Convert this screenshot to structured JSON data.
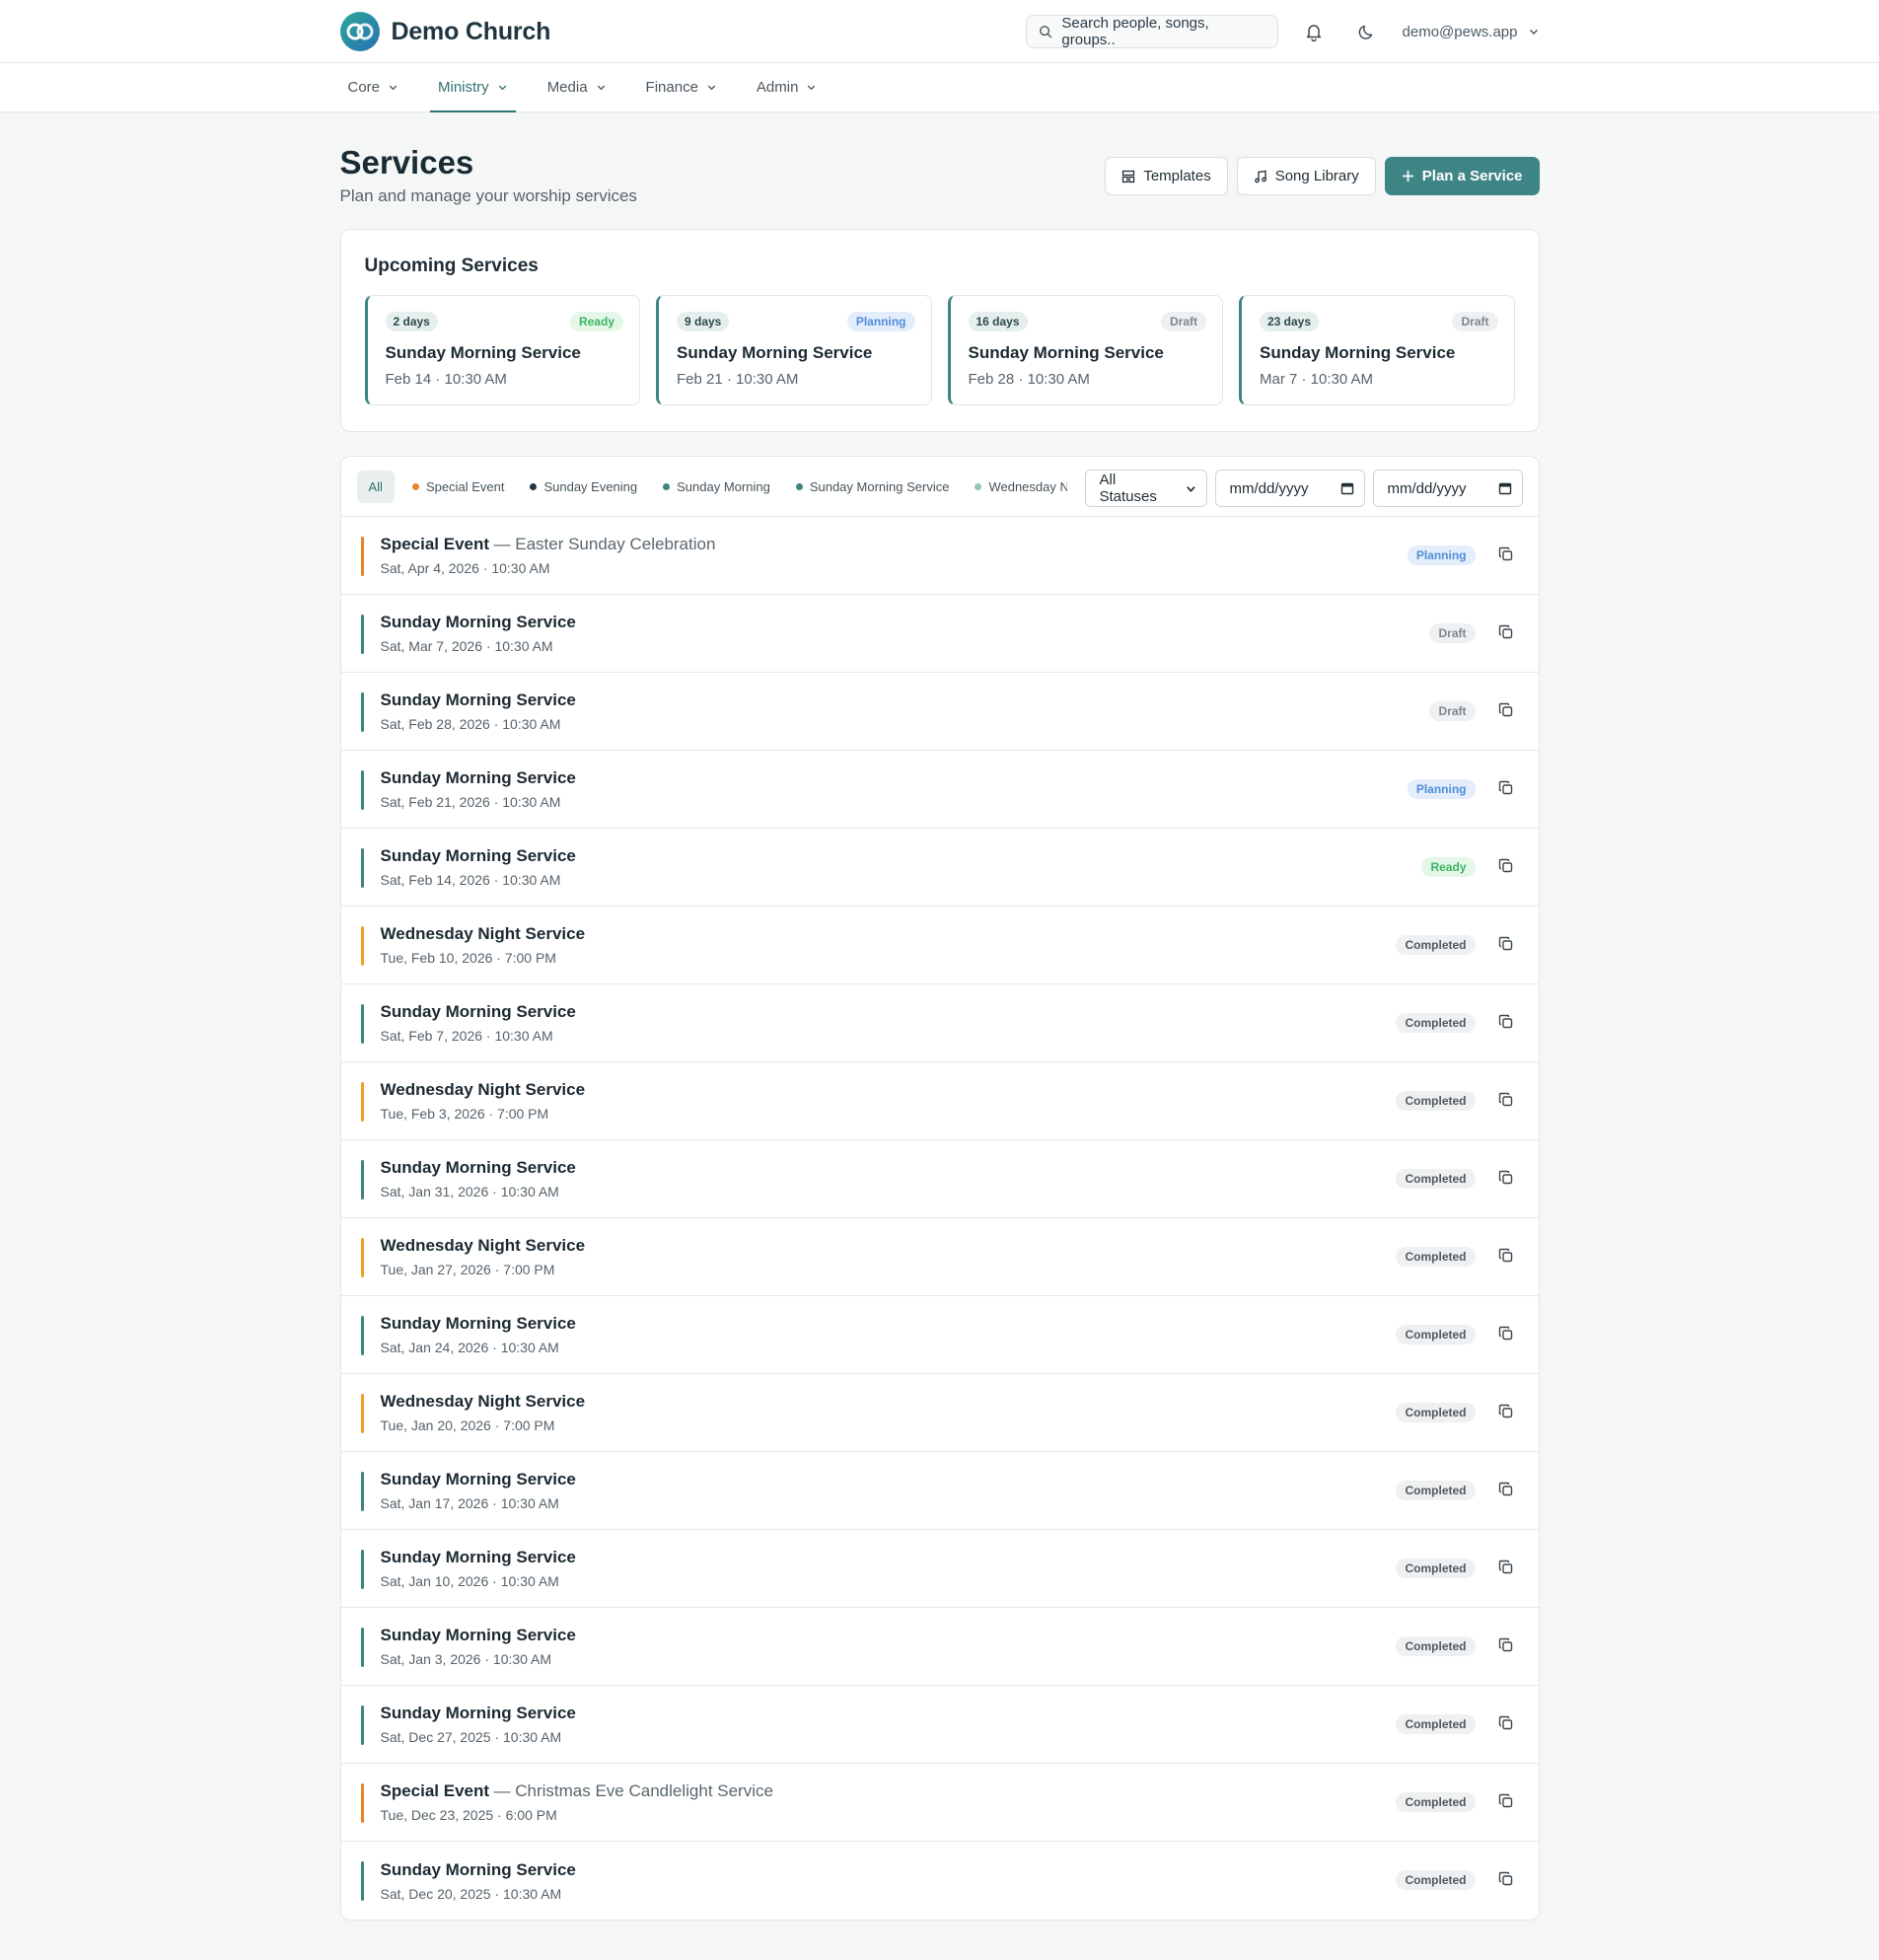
{
  "header": {
    "brand": "Demo Church",
    "search_placeholder": "Search people, songs, groups..",
    "user_email": "demo@pews.app"
  },
  "nav": {
    "items": [
      {
        "label": "Core",
        "active": false
      },
      {
        "label": "Ministry",
        "active": true
      },
      {
        "label": "Media",
        "active": false
      },
      {
        "label": "Finance",
        "active": false
      },
      {
        "label": "Admin",
        "active": false
      }
    ]
  },
  "page": {
    "title": "Services",
    "subtitle": "Plan and manage your worship services",
    "actions": {
      "templates": "Templates",
      "song_library": "Song Library",
      "plan": "Plan a Service"
    }
  },
  "upcoming": {
    "title": "Upcoming Services",
    "cards": [
      {
        "days": "2 days",
        "status": "Ready",
        "title": "Sunday Morning Service",
        "date": "Feb 14 · 10:30 AM"
      },
      {
        "days": "9 days",
        "status": "Planning",
        "title": "Sunday Morning Service",
        "date": "Feb 21 · 10:30 AM"
      },
      {
        "days": "16 days",
        "status": "Draft",
        "title": "Sunday Morning Service",
        "date": "Feb 28 · 10:30 AM"
      },
      {
        "days": "23 days",
        "status": "Draft",
        "title": "Sunday Morning Service",
        "date": "Mar 7 · 10:30 AM"
      }
    ]
  },
  "filters": {
    "chips": [
      {
        "label": "All",
        "color": ""
      },
      {
        "label": "Special Event",
        "color": "#e8842b"
      },
      {
        "label": "Sunday Evening",
        "color": "#1f3540"
      },
      {
        "label": "Sunday Morning",
        "color": "#3d8482"
      },
      {
        "label": "Sunday Morning Service",
        "color": "#3d8482"
      },
      {
        "label": "Wednesday Night Service",
        "color": "#8fc6b3"
      }
    ],
    "status_select": "All Statuses",
    "date_from_placeholder": "mm/dd/yyyy",
    "date_to_placeholder": "mm/dd/yyyy"
  },
  "services": [
    {
      "title": "Special Event",
      "subtitle": "— Easter Sunday Celebration",
      "date": "Sat, Apr 4, 2026 · 10:30 AM",
      "status": "Planning",
      "color": "#e8842b"
    },
    {
      "title": "Sunday Morning Service",
      "subtitle": "",
      "date": "Sat, Mar 7, 2026 · 10:30 AM",
      "status": "Draft",
      "color": "#3d8482"
    },
    {
      "title": "Sunday Morning Service",
      "subtitle": "",
      "date": "Sat, Feb 28, 2026 · 10:30 AM",
      "status": "Draft",
      "color": "#3d8482"
    },
    {
      "title": "Sunday Morning Service",
      "subtitle": "",
      "date": "Sat, Feb 21, 2026 · 10:30 AM",
      "status": "Planning",
      "color": "#3d8482"
    },
    {
      "title": "Sunday Morning Service",
      "subtitle": "",
      "date": "Sat, Feb 14, 2026 · 10:30 AM",
      "status": "Ready",
      "color": "#3d8482"
    },
    {
      "title": "Wednesday Night Service",
      "subtitle": "",
      "date": "Tue, Feb 10, 2026 · 7:00 PM",
      "status": "Completed",
      "color": "#f0a023"
    },
    {
      "title": "Sunday Morning Service",
      "subtitle": "",
      "date": "Sat, Feb 7, 2026 · 10:30 AM",
      "status": "Completed",
      "color": "#3d8482"
    },
    {
      "title": "Wednesday Night Service",
      "subtitle": "",
      "date": "Tue, Feb 3, 2026 · 7:00 PM",
      "status": "Completed",
      "color": "#f0a023"
    },
    {
      "title": "Sunday Morning Service",
      "subtitle": "",
      "date": "Sat, Jan 31, 2026 · 10:30 AM",
      "status": "Completed",
      "color": "#3d8482"
    },
    {
      "title": "Wednesday Night Service",
      "subtitle": "",
      "date": "Tue, Jan 27, 2026 · 7:00 PM",
      "status": "Completed",
      "color": "#f0a023"
    },
    {
      "title": "Sunday Morning Service",
      "subtitle": "",
      "date": "Sat, Jan 24, 2026 · 10:30 AM",
      "status": "Completed",
      "color": "#3d8482"
    },
    {
      "title": "Wednesday Night Service",
      "subtitle": "",
      "date": "Tue, Jan 20, 2026 · 7:00 PM",
      "status": "Completed",
      "color": "#f0a023"
    },
    {
      "title": "Sunday Morning Service",
      "subtitle": "",
      "date": "Sat, Jan 17, 2026 · 10:30 AM",
      "status": "Completed",
      "color": "#3d8482"
    },
    {
      "title": "Sunday Morning Service",
      "subtitle": "",
      "date": "Sat, Jan 10, 2026 · 10:30 AM",
      "status": "Completed",
      "color": "#3d8482"
    },
    {
      "title": "Sunday Morning Service",
      "subtitle": "",
      "date": "Sat, Jan 3, 2026 · 10:30 AM",
      "status": "Completed",
      "color": "#3d8482"
    },
    {
      "title": "Sunday Morning Service",
      "subtitle": "",
      "date": "Sat, Dec 27, 2025 · 10:30 AM",
      "status": "Completed",
      "color": "#3d8482"
    },
    {
      "title": "Special Event",
      "subtitle": "— Christmas Eve Candlelight Service",
      "date": "Tue, Dec 23, 2025 · 6:00 PM",
      "status": "Completed",
      "color": "#e8842b"
    },
    {
      "title": "Sunday Morning Service",
      "subtitle": "",
      "date": "Sat, Dec 20, 2025 · 10:30 AM",
      "status": "Completed",
      "color": "#3d8482"
    }
  ]
}
